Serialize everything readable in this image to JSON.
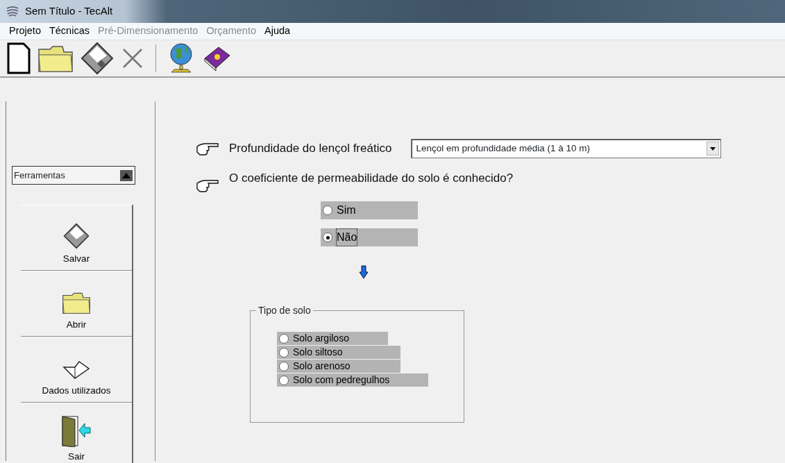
{
  "window": {
    "title": "Sem Título - TecAlt"
  },
  "menu": [
    {
      "label": "Projeto",
      "disabled": false
    },
    {
      "label": "Técnicas",
      "disabled": false
    },
    {
      "label": "Pré-Dimensionamento",
      "disabled": true
    },
    {
      "label": "Orçamento",
      "disabled": true
    },
    {
      "label": "Ajuda",
      "disabled": false
    }
  ],
  "sidebar": {
    "dropdown": "Ferramentas",
    "buttons": [
      {
        "label": "Salvar"
      },
      {
        "label": "Abrir"
      },
      {
        "label": "Dados utilizados"
      },
      {
        "label": "Sair"
      }
    ]
  },
  "form": {
    "depth_label": "Profundidade do lençol freático",
    "depth_value": "Lençol em profundidade média (1 à 10 m)",
    "question": "O coeficiente de permeabilidade do solo é conhecido?",
    "answers": [
      {
        "label": "Sim",
        "selected": false
      },
      {
        "label": "Não",
        "selected": true
      }
    ],
    "soil_group": {
      "title": "Tipo de solo",
      "options": [
        {
          "label": "Solo argiloso",
          "selected": false
        },
        {
          "label": "Solo siltoso",
          "selected": false
        },
        {
          "label": "Solo arenoso",
          "selected": false
        },
        {
          "label": "Solo com pedregulhos",
          "selected": false
        }
      ]
    }
  }
}
